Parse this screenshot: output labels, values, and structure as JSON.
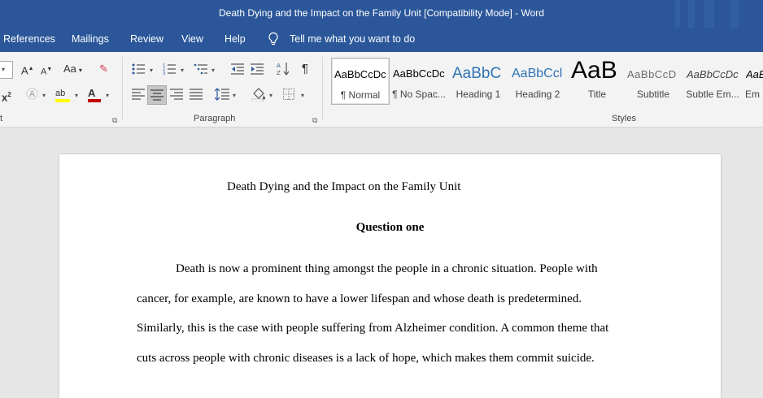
{
  "window": {
    "title": "Death Dying and the Impact on the Family Unit [Compatibility Mode]  -  Word"
  },
  "menu": {
    "items": [
      "References",
      "Mailings",
      "Review",
      "View",
      "Help"
    ],
    "tell_me": "Tell me what you want to do"
  },
  "ribbon": {
    "font_group_label": "t",
    "paragraph_group_label": "Paragraph",
    "styles_group_label": "Styles",
    "font_case_label": "Aa",
    "styles": [
      {
        "sample": "AaBbCcDc",
        "name": "¶ Normal"
      },
      {
        "sample": "AaBbCcDc",
        "name": "¶ No Spac..."
      },
      {
        "sample": "AaBbC",
        "name": "Heading 1"
      },
      {
        "sample": "AaBbCcl",
        "name": "Heading 2"
      },
      {
        "sample": "AaB",
        "name": "Title"
      },
      {
        "sample": "AaBbCcD",
        "name": "Subtitle"
      },
      {
        "sample": "AaBbCcDc",
        "name": "Subtle Em..."
      },
      {
        "sample": "AaBl",
        "name": "Em"
      }
    ],
    "colors": {
      "highlight": "#ffff00",
      "font_color": "#c00000"
    }
  },
  "document": {
    "title": "Death Dying and the Impact on the Family Unit",
    "heading": "Question one",
    "lines": [
      "Death is now a prominent thing amongst the people in a chronic situation. People with",
      "cancer, for example, are known to have a lower lifespan and whose death is predetermined.",
      "Similarly, this is the case with people suffering from Alzheimer condition. A common theme that",
      "cuts across people with chronic diseases is a lack of hope, which makes them commit suicide."
    ]
  },
  "icons": [
    "lightbulb-icon",
    "grow-font-icon",
    "shrink-font-icon",
    "clear-formatting-icon",
    "superscript-icon",
    "text-effects-icon",
    "highlight-icon",
    "font-color-icon",
    "bullets-icon",
    "numbering-icon",
    "multilevel-list-icon",
    "decrease-indent-icon",
    "increase-indent-icon",
    "sort-icon",
    "pilcrow-icon",
    "align-left-icon",
    "align-center-icon",
    "align-right-icon",
    "justify-icon",
    "line-spacing-icon",
    "shading-icon",
    "borders-icon",
    "dialog-launcher-icon"
  ]
}
